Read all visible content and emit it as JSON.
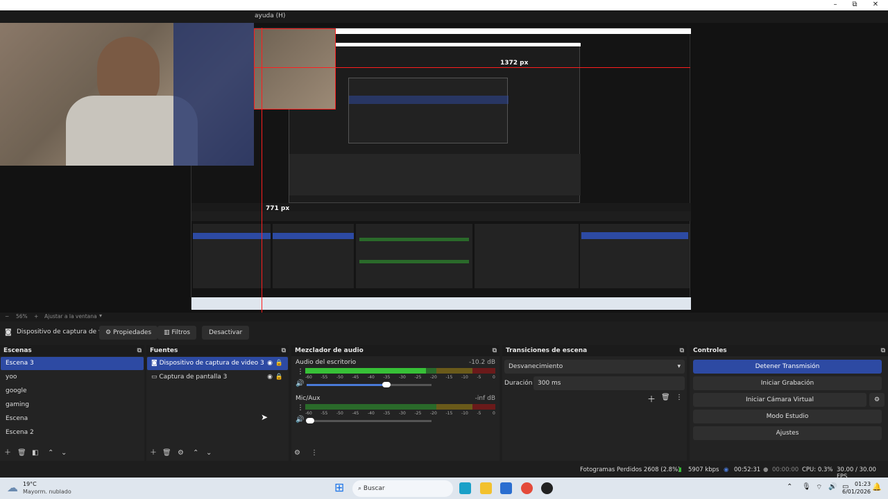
{
  "window": {
    "menu_help": "ayuda (H)",
    "min": "–",
    "max": "⧉",
    "close": "✕"
  },
  "preview_overlay": {
    "label_top": "1372 px",
    "label_left": "771 px",
    "nested_label": "1372 px"
  },
  "zoom": {
    "minus": "−",
    "level": "56%",
    "plus": "+",
    "fit": "Ajustar a la ventana"
  },
  "toolbar": {
    "source_name": "Dispositivo de captura de v",
    "properties": "Propiedades",
    "filters": "Filtros",
    "deactivate": "Desactivar"
  },
  "scenes": {
    "title": "Escenas",
    "items": [
      "Escena 3",
      "yoo",
      "google",
      "gaming",
      "Escena",
      "Escena 2"
    ],
    "selected": 0
  },
  "sources": {
    "title": "Fuentes",
    "items": [
      "Dispositivo de captura de video 3",
      "Captura de pantalla 3"
    ]
  },
  "mixer": {
    "title": "Mezclador de audio",
    "channels": [
      {
        "name": "Audio del escritorio",
        "db": "-10.2 dB",
        "level": 0.92,
        "volume": 0.64
      },
      {
        "name": "Mic/Aux",
        "db": "-inf dB",
        "level": 0.0,
        "volume": 0.03
      }
    ],
    "ticks": [
      "-60",
      "-55",
      "-50",
      "-45",
      "-40",
      "-35",
      "-30",
      "-25",
      "-20",
      "-15",
      "-10",
      "-5",
      "0"
    ]
  },
  "transitions": {
    "title": "Transiciones de escena",
    "selected": "Desvanecimiento",
    "duration_label": "Duración",
    "duration_value": "300 ms"
  },
  "controls": {
    "title": "Controles",
    "buttons": [
      "Detener Transmisión",
      "Iniciar Grabación",
      "Iniciar Cámara Virtual",
      "Modo Estudio",
      "Ajustes"
    ]
  },
  "status": {
    "dropped": "Fotogramas Perdidos 2608 (2.8%)",
    "bitrate": "5907 kbps",
    "live_time": "00:52:31",
    "rec_time": "00:00:00",
    "cpu": "CPU: 0.3%",
    "fps": "30.00 / 30.00 FPS"
  },
  "taskbar": {
    "temp": "19°C",
    "weather": "Mayorm. nublado",
    "search": "Buscar",
    "time": "01:23",
    "date": "6/01/2026"
  },
  "colors": {
    "selected": "#2d4aa3",
    "accent_red": "#ff1e1e",
    "meter_green": "#37c037"
  }
}
